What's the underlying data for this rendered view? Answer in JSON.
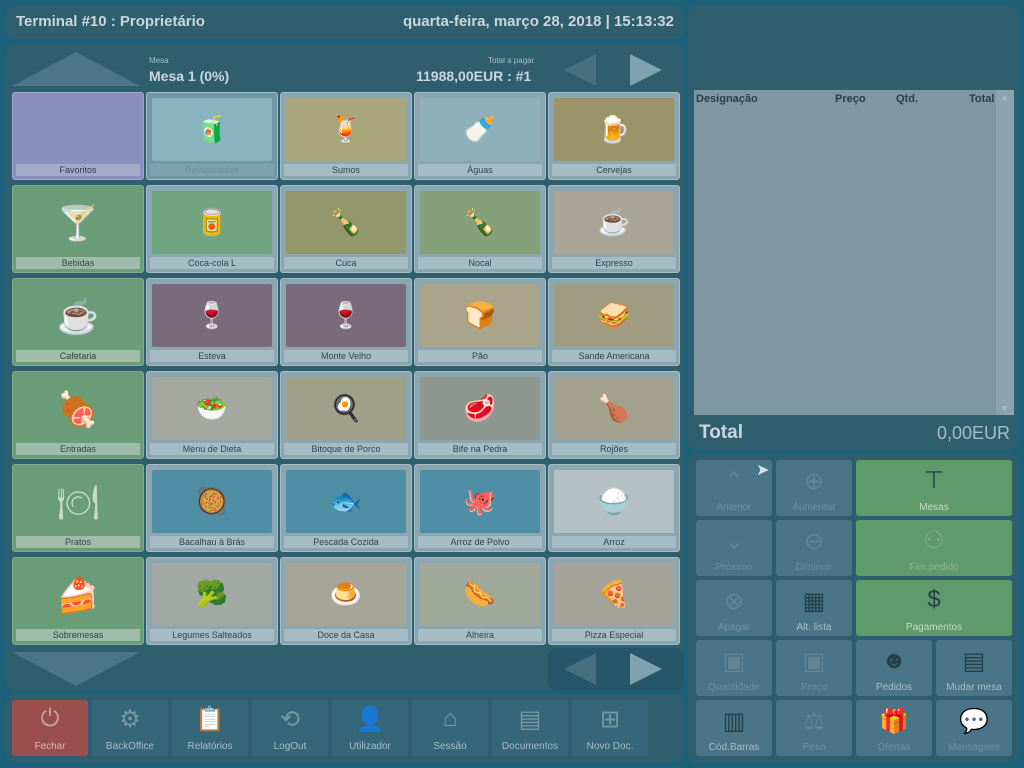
{
  "header": {
    "title": "Terminal #10 : Proprietário",
    "datetime": "quarta-feira, março 28, 2018 | 15:13:32"
  },
  "table_info": {
    "mesa_caption": "Mesa",
    "mesa_value": "Mesa 1 (0%)",
    "total_caption": "Total a pagar",
    "total_value": "11988,00EUR : #1"
  },
  "categories": [
    "Favoritos",
    "Bebidas",
    "Cafetaria",
    "Entradas",
    "Pratos",
    "Sobremesas"
  ],
  "products": [
    [
      "Refrigerantes",
      "Sumos",
      "Águas",
      "Cervejas"
    ],
    [
      "Coca-cola L",
      "Cuca",
      "Nocal",
      "Expresso"
    ],
    [
      "Esteva",
      "Monte Velho",
      "Pão",
      "Sande Americana"
    ],
    [
      "Menu de Dieta",
      "Bitoque de Porco",
      "Bife na Pedra",
      "Rojões"
    ],
    [
      "Bacalhau à Brás",
      "Pescada Cozida",
      "Arroz de Polvo",
      "Arroz"
    ],
    [
      "Legumes Salteados",
      "Doce da Casa",
      "Alheira",
      "Pizza Especial"
    ]
  ],
  "bottom_bar": [
    "Fechar",
    "BackOffice",
    "Relatórios",
    "LogOut",
    "Utilizador",
    "Sessão",
    "Documentos",
    "Novo Doc."
  ],
  "order_list": {
    "col_designacao": "Designação",
    "col_preco": "Preço",
    "col_qtd": "Qtd.",
    "col_total": "Total",
    "total_label": "Total",
    "total_value": "0,00EUR"
  },
  "keypad": {
    "anterior": "Anterior",
    "aumentar": "Aumentar",
    "mesas": "Mesas",
    "proximo": "Próximo",
    "diminuir": "Diminuir",
    "fim_pedido": "Fim pedido",
    "apagar": "Apagar",
    "alt_lista": "Alt. lista",
    "pagamentos": "Pagamentos",
    "quantidade": "Quantidade",
    "preco": "Preço",
    "pedidos": "Pedidos",
    "mudar_mesa": "Mudar mesa",
    "cod_barras": "Cód.Barras",
    "peso": "Peso",
    "ofertas": "Ofertas",
    "mensagens": "Mensagens"
  },
  "icons": {
    "bottom_bar": [
      "power-icon",
      "gears-icon",
      "report-icon",
      "logout-icon",
      "user-icon",
      "session-icon",
      "documents-icon",
      "new-doc-icon"
    ]
  },
  "colors": {
    "favoritos": "#8b8fc0",
    "category_green": "#6a9c78",
    "fechar_red": "#a04a4a",
    "action_green": "#5f9a6a"
  }
}
